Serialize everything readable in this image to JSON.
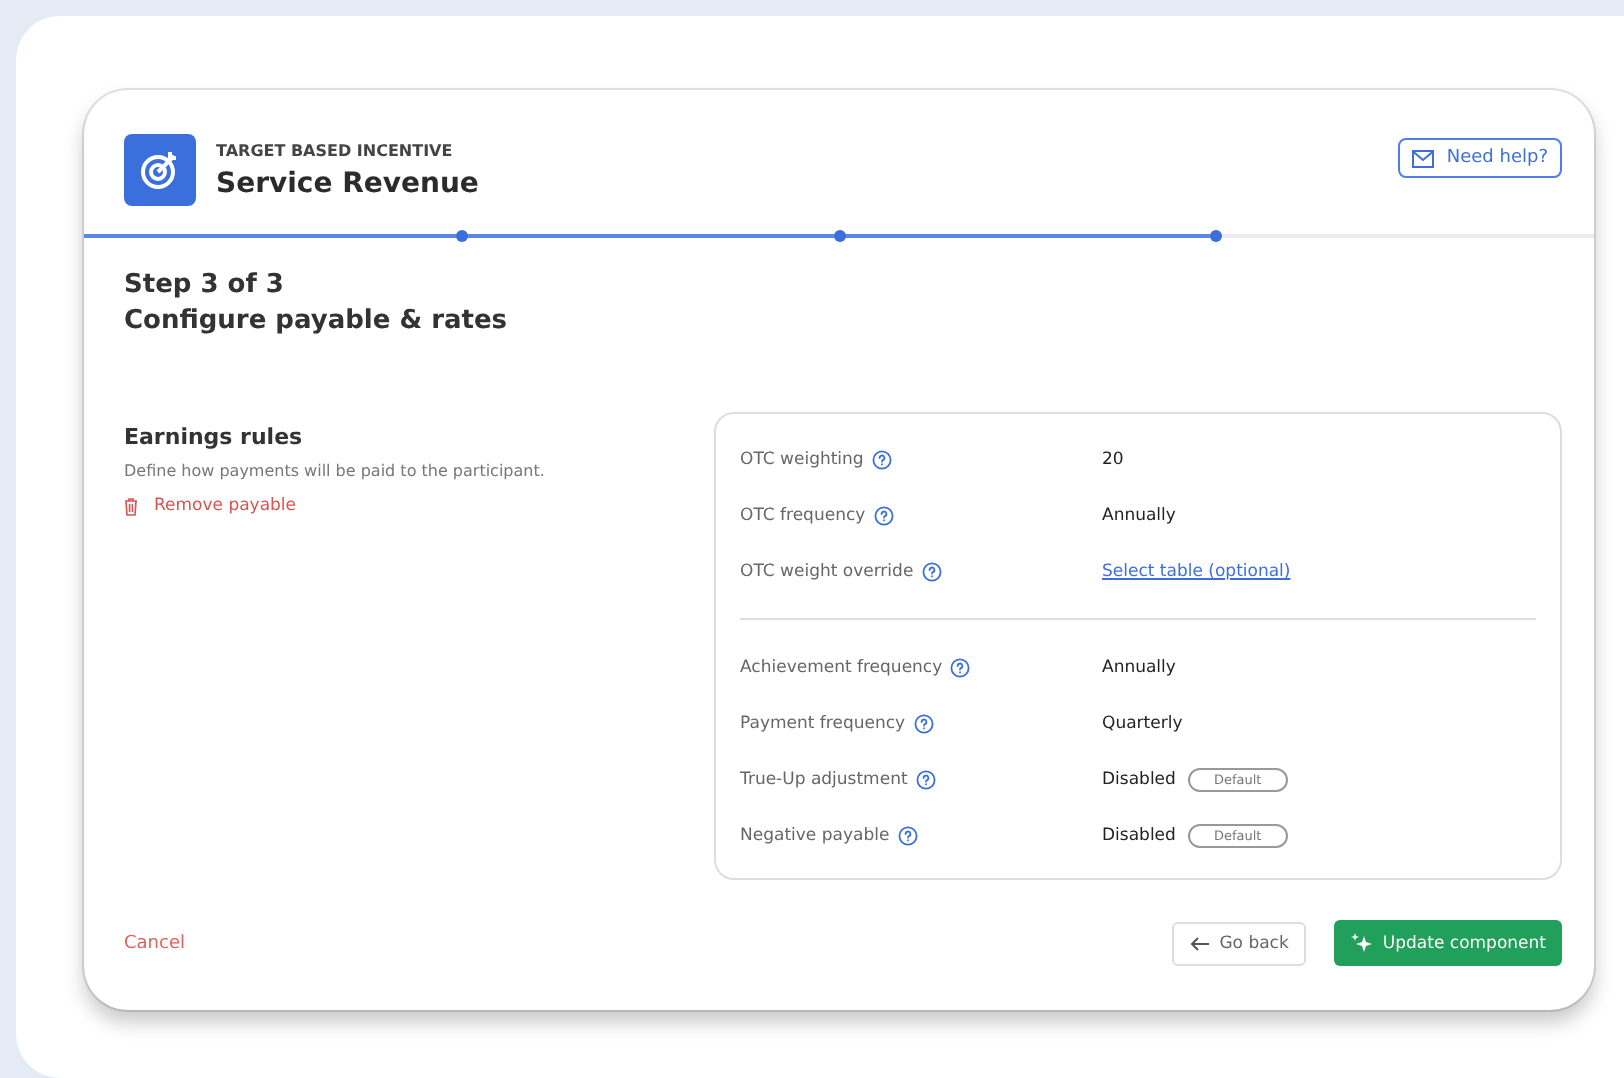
{
  "header": {
    "eyebrow": "TARGET BASED INCENTIVE",
    "title": "Service Revenue",
    "help_button": "Need help?"
  },
  "progress": {
    "level": 0.75
  },
  "step": {
    "counter": "Step 3 of 3",
    "title": "Configure payable & rates"
  },
  "earnings": {
    "title": "Earnings rules",
    "description": "Define how payments will be paid to the participant.",
    "remove_link": "Remove payable"
  },
  "rule_groups": [
    {
      "rows": [
        {
          "label": "OTC weighting",
          "kind": "text",
          "value": "20"
        },
        {
          "label": "OTC frequency",
          "kind": "text",
          "value": "Annually"
        },
        {
          "label": "OTC weight override",
          "kind": "link",
          "value": "Select table (optional)"
        }
      ]
    },
    {
      "rows": [
        {
          "label": "Achievement frequency",
          "kind": "text",
          "value": "Annually"
        },
        {
          "label": "Payment frequency",
          "kind": "text",
          "value": "Quarterly"
        },
        {
          "label": "True-Up adjustment",
          "kind": "badge",
          "value": "Disabled",
          "badge": "Default"
        },
        {
          "label": "Negative payable",
          "kind": "badge",
          "value": "Disabled",
          "badge": "Default"
        }
      ]
    }
  ],
  "footer": {
    "cancel": "Cancel",
    "back": "Go back",
    "primary": "Update component"
  }
}
